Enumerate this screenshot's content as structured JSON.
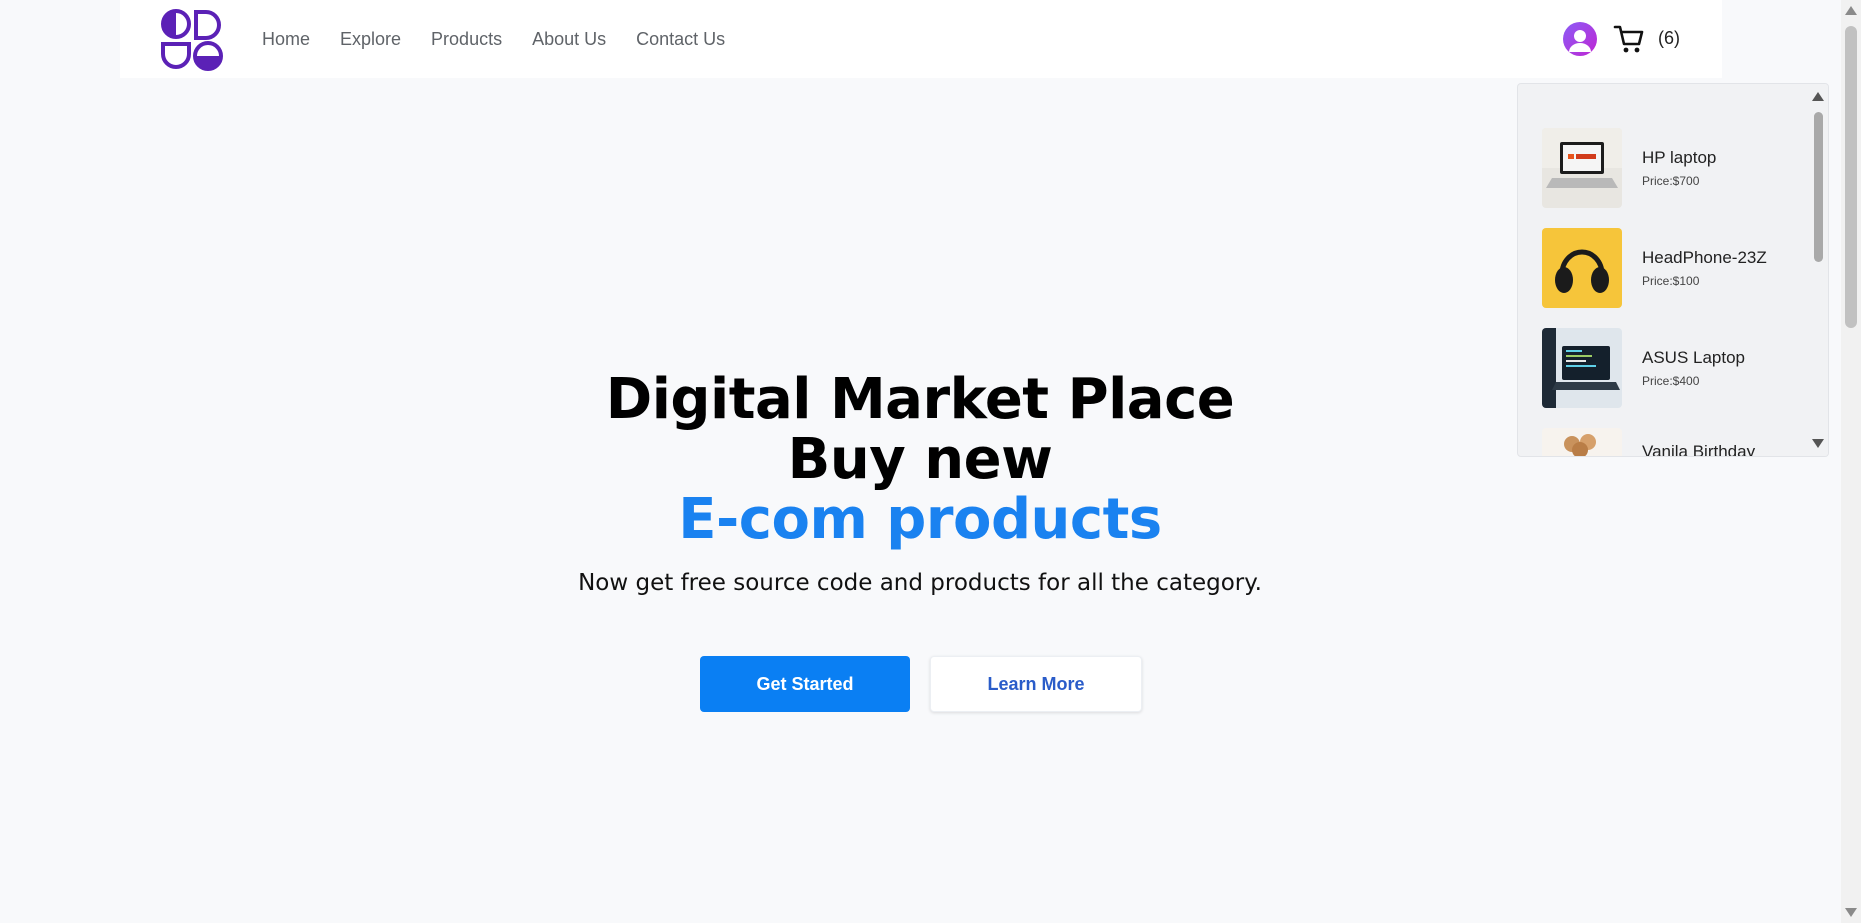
{
  "nav": {
    "items": [
      {
        "label": "Home"
      },
      {
        "label": "Explore"
      },
      {
        "label": "Products"
      },
      {
        "label": "About Us"
      },
      {
        "label": "Contact Us"
      }
    ]
  },
  "cart": {
    "count_label": "(6)",
    "items": [
      {
        "name": "HP laptop",
        "price": "Price:$700",
        "thumb": "laptop-photo"
      },
      {
        "name": "HeadPhone-23Z",
        "price": "Price:$100",
        "thumb": "headphone-photo"
      },
      {
        "name": "ASUS Laptop",
        "price": "Price:$400",
        "thumb": "laptop-code-photo"
      },
      {
        "name": "Vanila Birthday",
        "price": "",
        "thumb": "cake-photo"
      }
    ]
  },
  "hero": {
    "line1": "Digital Market Place",
    "line2": "Buy new",
    "line3": "E-com products",
    "subtitle": "Now get free source code and products for all the category.",
    "primary_button": "Get Started",
    "secondary_button": "Learn More"
  },
  "colors": {
    "accent": "#1a82f0",
    "primary_button": "#0a7ff3",
    "logo": "#5b21b6"
  }
}
